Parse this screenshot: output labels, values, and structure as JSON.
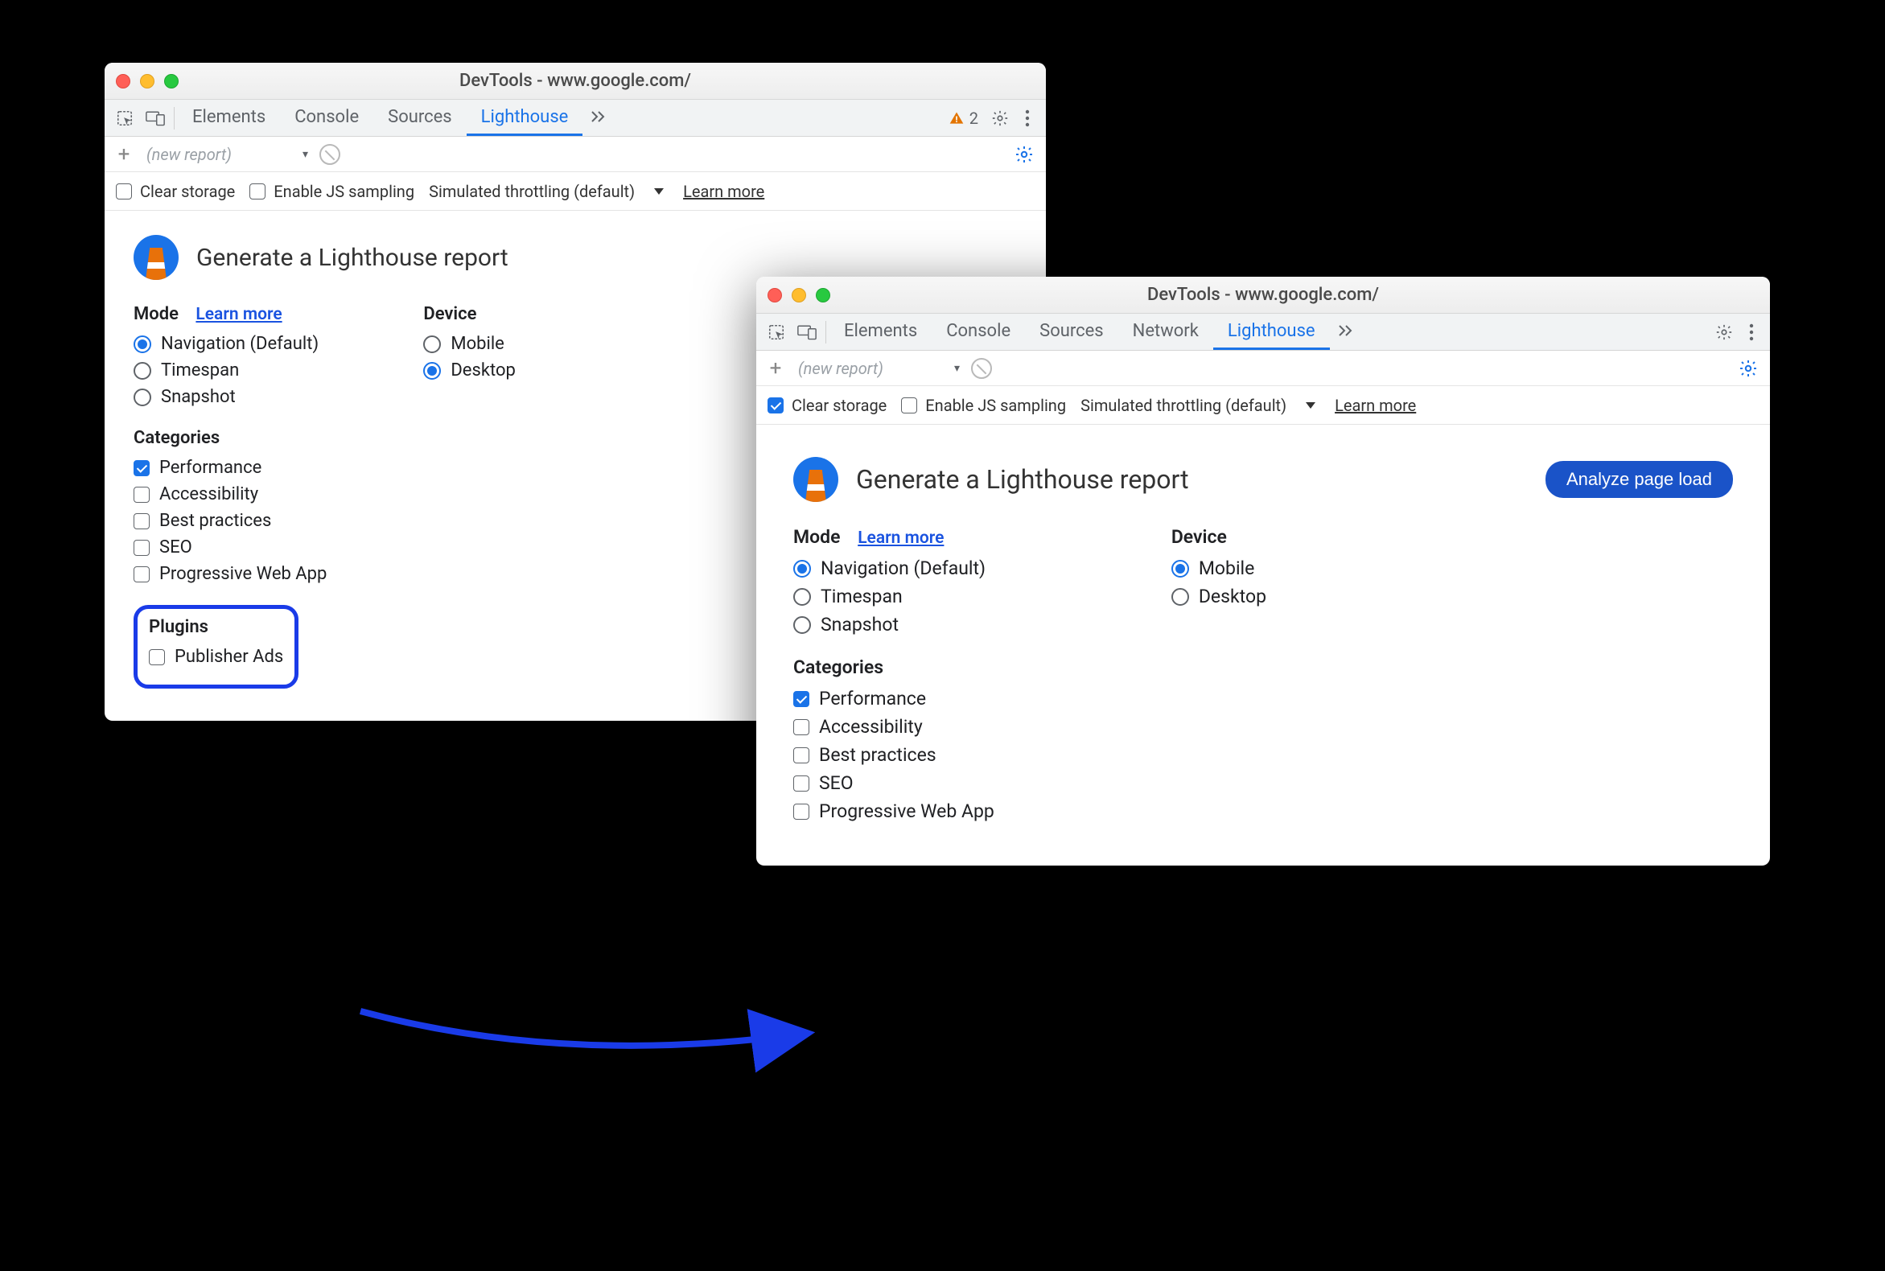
{
  "windowA": {
    "title": "DevTools - www.google.com/",
    "tabs": [
      "Elements",
      "Console",
      "Sources",
      "Lighthouse"
    ],
    "activeTab": "Lighthouse",
    "warnCount": "2",
    "newReport": "(new report)",
    "opt": {
      "clearStorage": "Clear storage",
      "enableJs": "Enable JS sampling",
      "throttle": "Simulated throttling (default)",
      "learn": "Learn more"
    },
    "header": "Generate a Lighthouse report",
    "mode": {
      "title": "Mode",
      "learn": "Learn more",
      "items": [
        "Navigation (Default)",
        "Timespan",
        "Snapshot"
      ],
      "selected": 0
    },
    "device": {
      "title": "Device",
      "items": [
        "Mobile",
        "Desktop"
      ],
      "selected": 1
    },
    "categories": {
      "title": "Categories",
      "items": [
        "Performance",
        "Accessibility",
        "Best practices",
        "SEO",
        "Progressive Web App"
      ],
      "checked": [
        true,
        false,
        false,
        false,
        false
      ]
    },
    "plugins": {
      "title": "Plugins",
      "items": [
        "Publisher Ads"
      ],
      "checked": [
        false
      ]
    }
  },
  "windowB": {
    "title": "DevTools - www.google.com/",
    "tabs": [
      "Elements",
      "Console",
      "Sources",
      "Network",
      "Lighthouse"
    ],
    "activeTab": "Lighthouse",
    "newReport": "(new report)",
    "opt": {
      "clearStorage": "Clear storage",
      "clearChecked": true,
      "enableJs": "Enable JS sampling",
      "throttle": "Simulated throttling (default)",
      "learn": "Learn more"
    },
    "header": "Generate a Lighthouse report",
    "analyze": "Analyze page load",
    "mode": {
      "title": "Mode",
      "learn": "Learn more",
      "items": [
        "Navigation (Default)",
        "Timespan",
        "Snapshot"
      ],
      "selected": 0
    },
    "device": {
      "title": "Device",
      "items": [
        "Mobile",
        "Desktop"
      ],
      "selected": 0
    },
    "categories": {
      "title": "Categories",
      "items": [
        "Performance",
        "Accessibility",
        "Best practices",
        "SEO",
        "Progressive Web App"
      ],
      "checked": [
        true,
        false,
        false,
        false,
        false
      ]
    }
  }
}
